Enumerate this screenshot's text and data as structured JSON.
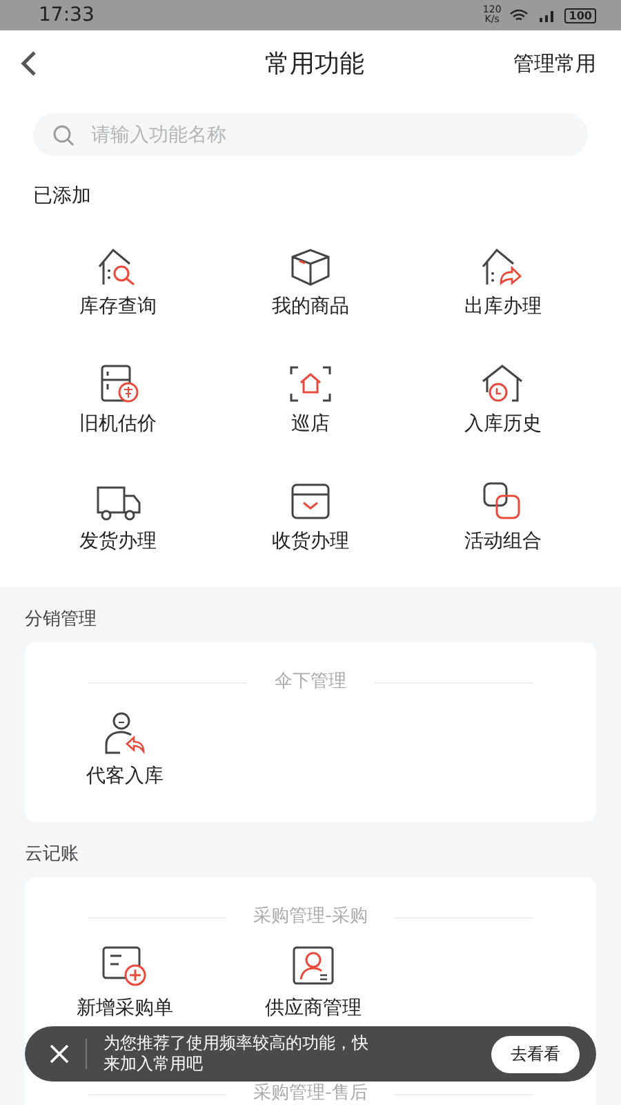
{
  "status_bar": {
    "time": "17:33",
    "speed": "120",
    "speed_unit": "K/s",
    "battery": "100"
  },
  "header": {
    "title": "常用功能",
    "action": "管理常用"
  },
  "search": {
    "placeholder": "请输入功能名称"
  },
  "added": {
    "title": "已添加",
    "items": [
      {
        "label": "库存查询"
      },
      {
        "label": "我的商品"
      },
      {
        "label": "出库办理"
      },
      {
        "label": "旧机估价"
      },
      {
        "label": "巡店"
      },
      {
        "label": "入库历史"
      },
      {
        "label": "发货办理"
      },
      {
        "label": "收货办理"
      },
      {
        "label": "活动组合"
      }
    ]
  },
  "sections": [
    {
      "title": "分销管理",
      "groups": [
        {
          "title": "伞下管理",
          "items": [
            {
              "label": "代客入库"
            }
          ]
        }
      ]
    },
    {
      "title": "云记账",
      "groups": [
        {
          "title": "采购管理-采购",
          "items": [
            {
              "label": "新增采购单"
            },
            {
              "label": "供应商管理"
            }
          ]
        },
        {
          "title": "采购管理-售后"
        }
      ]
    }
  ],
  "toast": {
    "message": "为您推荐了使用频率较高的功能，快来加入常用吧",
    "button": "去看看"
  }
}
